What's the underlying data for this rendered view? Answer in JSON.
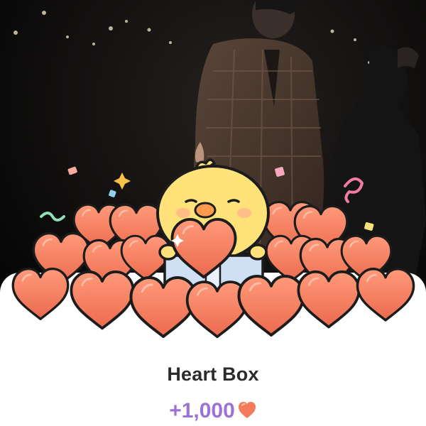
{
  "popup": {
    "title": "Heart Box",
    "reward_amount": "+1,000",
    "reward_icon": "heart-icon",
    "background": "photo-of-person-at-night",
    "illustration": "yellow-chick-holding-heart-in-heart-pile"
  },
  "colors": {
    "title": "#2b2b2b",
    "reward": "#9b72d6",
    "heart_fill": "#f27b5c",
    "heart_outline": "#1c1c1c",
    "chick": "#ffe27a",
    "gift_box": "#cfe0f5"
  }
}
